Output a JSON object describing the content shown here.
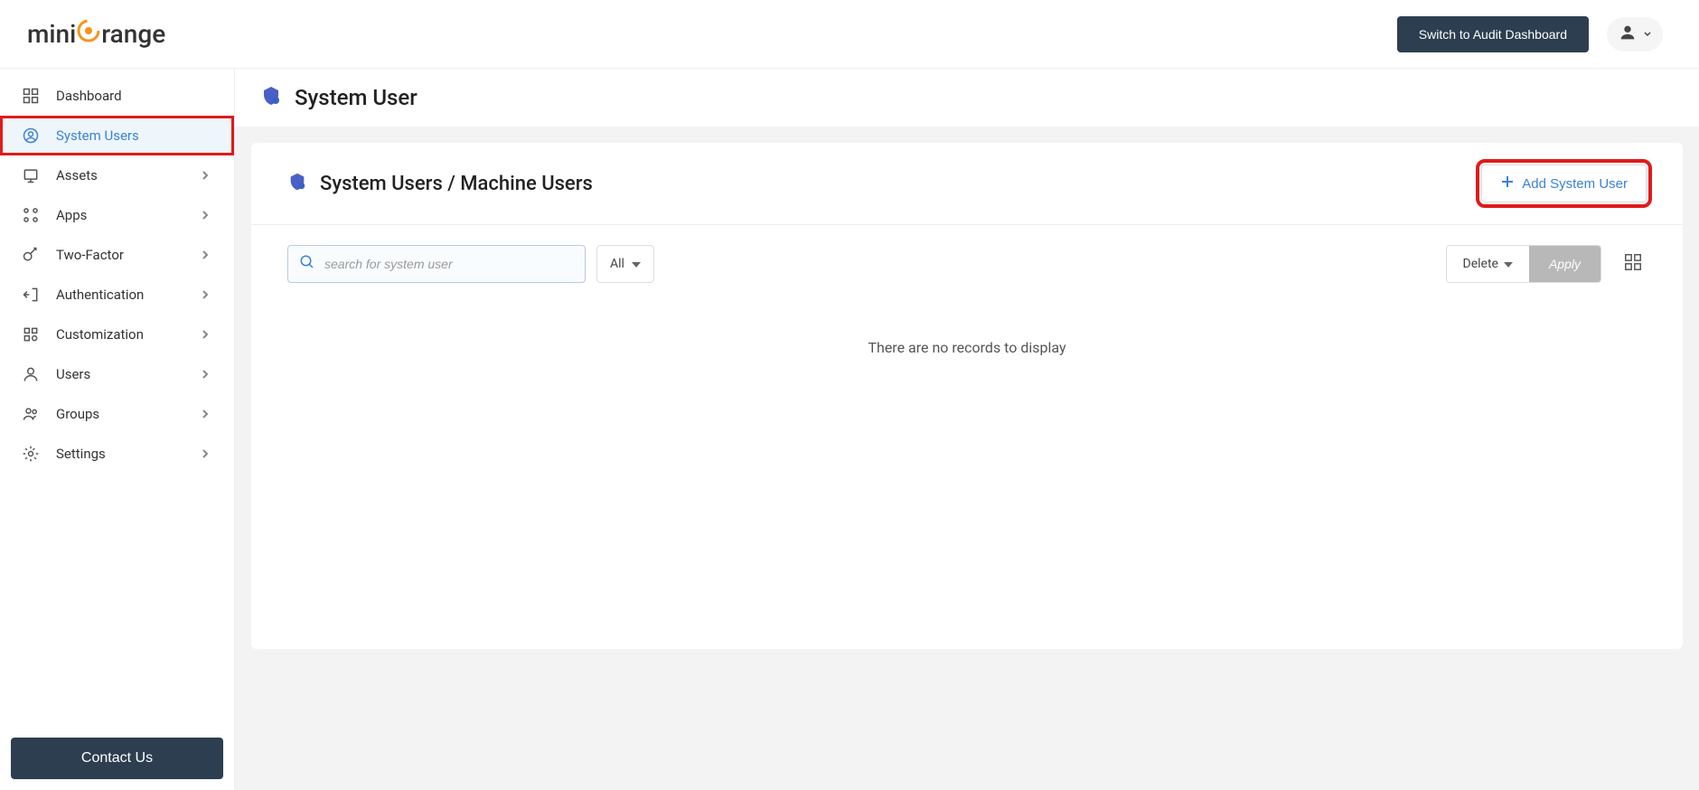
{
  "header": {
    "logo_pre": "mini",
    "logo_accent_icon": "◎",
    "logo_post": "range",
    "switch_label": "Switch to Audit Dashboard"
  },
  "sidebar": {
    "items": [
      {
        "label": "Dashboard",
        "expandable": false,
        "active": false
      },
      {
        "label": "System Users",
        "expandable": false,
        "active": true
      },
      {
        "label": "Assets",
        "expandable": true,
        "active": false
      },
      {
        "label": "Apps",
        "expandable": true,
        "active": false
      },
      {
        "label": "Two-Factor",
        "expandable": true,
        "active": false
      },
      {
        "label": "Authentication",
        "expandable": true,
        "active": false
      },
      {
        "label": "Customization",
        "expandable": true,
        "active": false
      },
      {
        "label": "Users",
        "expandable": true,
        "active": false
      },
      {
        "label": "Groups",
        "expandable": true,
        "active": false
      },
      {
        "label": "Settings",
        "expandable": true,
        "active": false
      }
    ],
    "contact_label": "Contact Us"
  },
  "page": {
    "title": "System User",
    "card_title": "System Users / Machine Users",
    "add_button": "Add System User",
    "search_placeholder": "search for system user",
    "filter_label": "All",
    "delete_label": "Delete",
    "apply_label": "Apply",
    "empty_message": "There are no records to display"
  }
}
